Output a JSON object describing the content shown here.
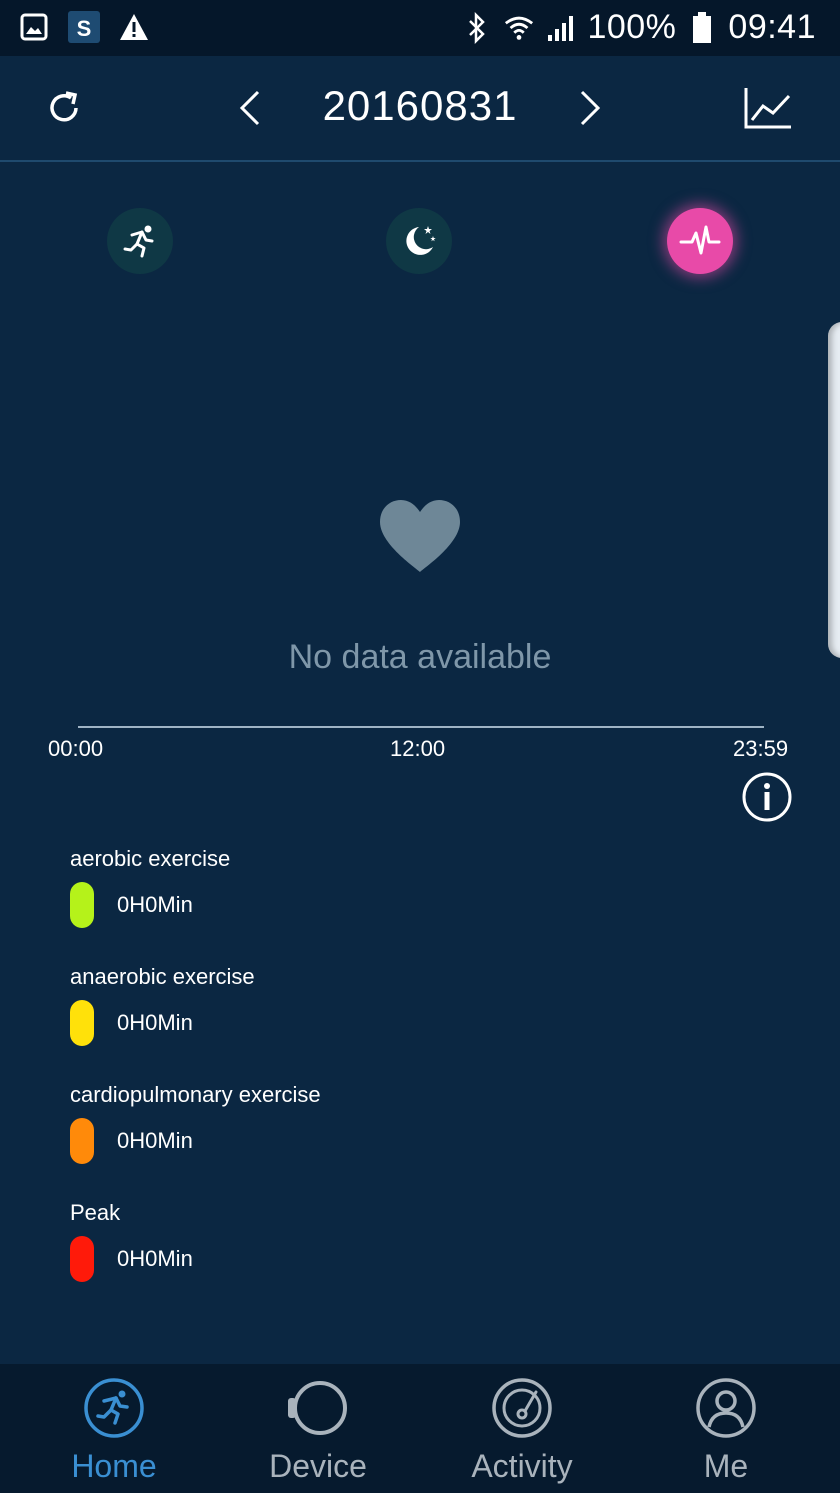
{
  "status_bar": {
    "battery": "100%",
    "time": "09:41",
    "notification_icons": [
      "gallery-icon",
      "app-s-icon",
      "warning-icon"
    ],
    "system_icons": [
      "bluetooth-icon",
      "wifi-icon",
      "signal-icon",
      "battery-icon"
    ]
  },
  "header": {
    "date": "20160831",
    "left_icon": "refresh-icon",
    "prev_icon": "chevron-left-icon",
    "next_icon": "chevron-right-icon",
    "right_icon": "trend-chart-icon"
  },
  "modes": [
    {
      "icon": "running-icon",
      "active": false
    },
    {
      "icon": "sleep-moon-icon",
      "active": false
    },
    {
      "icon": "heart-rate-icon",
      "active": true,
      "color": "#e84aa8"
    }
  ],
  "empty_state": {
    "icon": "heart-icon",
    "message": "No data available"
  },
  "timeline": {
    "start": "00:00",
    "middle": "12:00",
    "end": "23:59"
  },
  "legend": [
    {
      "label": "aerobic exercise",
      "value": "0H0Min",
      "color": "#b5f21a"
    },
    {
      "label": "anaerobic exercise",
      "value": "0H0Min",
      "color": "#ffe10a"
    },
    {
      "label": "cardiopulmonary exercise",
      "value": "0H0Min",
      "color": "#ff8a0a"
    },
    {
      "label": "Peak",
      "value": "0H0Min",
      "color": "#ff1a0a"
    }
  ],
  "nav": [
    {
      "label": "Home",
      "icon": "running-circle-icon",
      "active": true
    },
    {
      "label": "Device",
      "icon": "watch-icon",
      "active": false
    },
    {
      "label": "Activity",
      "icon": "radar-icon",
      "active": false
    },
    {
      "label": "Me",
      "icon": "user-icon",
      "active": false
    }
  ],
  "colors": {
    "background": "#0b2742",
    "accent": "#3a8fd2",
    "heart_rate": "#e84aa8"
  }
}
